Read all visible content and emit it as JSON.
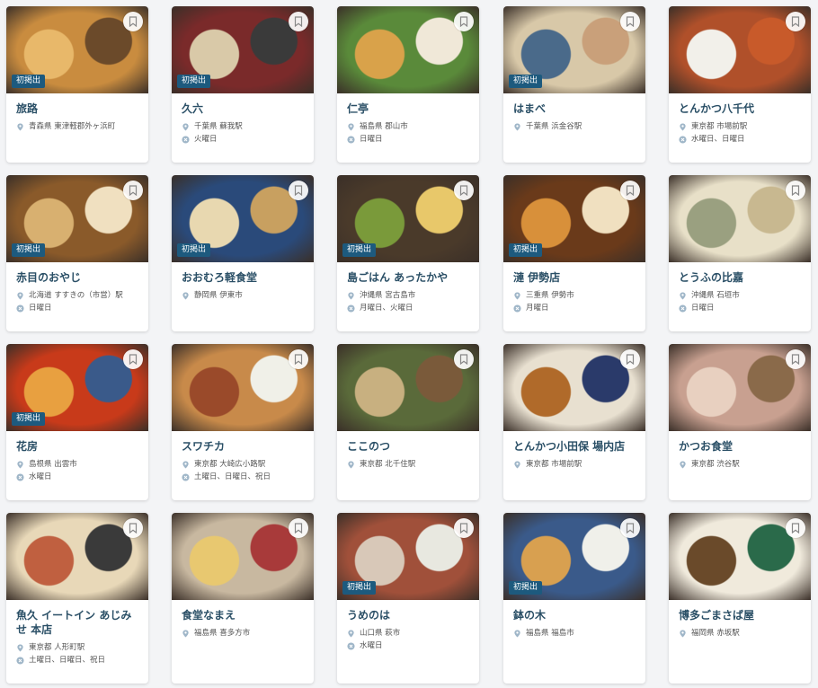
{
  "badge_label": "初掲出",
  "icons": {
    "bookmark": "bookmark-icon",
    "location": "location-pin-icon",
    "closed_days": "calendar-icon"
  },
  "colors": {
    "title": "#2a4f66",
    "badge": "#1d5a7e",
    "icon": "#9fb6c8"
  },
  "restaurants": [
    {
      "name": "旅路",
      "location": "青森県 東津軽郡外ヶ浜町",
      "closed": "",
      "first_listing": true
    },
    {
      "name": "久六",
      "location": "千葉県 蘇我駅",
      "closed": "火曜日",
      "first_listing": true
    },
    {
      "name": "仁亭",
      "location": "福島県 郡山市",
      "closed": "日曜日",
      "first_listing": false
    },
    {
      "name": "はまべ",
      "location": "千葉県 浜金谷駅",
      "closed": "",
      "first_listing": true
    },
    {
      "name": "とんかつ八千代",
      "location": "東京都 市場前駅",
      "closed": "水曜日、日曜日",
      "first_listing": false
    },
    {
      "name": "赤目のおやじ",
      "location": "北海道 すすきの（市営）駅",
      "closed": "日曜日",
      "first_listing": true
    },
    {
      "name": "おおむろ軽食堂",
      "location": "静岡県 伊東市",
      "closed": "",
      "first_listing": true
    },
    {
      "name": "島ごはん あったかや",
      "location": "沖縄県 宮古島市",
      "closed": "月曜日、火曜日",
      "first_listing": true
    },
    {
      "name": "漣 伊勢店",
      "location": "三重県 伊勢市",
      "closed": "月曜日",
      "first_listing": true
    },
    {
      "name": "とうふの比嘉",
      "location": "沖縄県 石垣市",
      "closed": "日曜日",
      "first_listing": false
    },
    {
      "name": "花房",
      "location": "島根県 出雲市",
      "closed": "水曜日",
      "first_listing": true
    },
    {
      "name": "スワチカ",
      "location": "東京都 大崎広小路駅",
      "closed": "土曜日、日曜日、祝日",
      "first_listing": false
    },
    {
      "name": "ここのつ",
      "location": "東京都 北千住駅",
      "closed": "",
      "first_listing": false
    },
    {
      "name": "とんかつ小田保 場内店",
      "location": "東京都 市場前駅",
      "closed": "",
      "first_listing": false
    },
    {
      "name": "かつお食堂",
      "location": "東京都 渋谷駅",
      "closed": "",
      "first_listing": false
    },
    {
      "name": "魚久 イートイン あじみせ 本店",
      "location": "東京都 人形町駅",
      "closed": "土曜日、日曜日、祝日",
      "first_listing": false
    },
    {
      "name": "食堂なまえ",
      "location": "福島県 喜多方市",
      "closed": "",
      "first_listing": false
    },
    {
      "name": "うめのは",
      "location": "山口県 萩市",
      "closed": "水曜日",
      "first_listing": true
    },
    {
      "name": "鉢の木",
      "location": "福島県 福島市",
      "closed": "",
      "first_listing": true
    },
    {
      "name": "博多ごまさば屋",
      "location": "福岡県 赤坂駅",
      "closed": "",
      "first_listing": false
    }
  ]
}
